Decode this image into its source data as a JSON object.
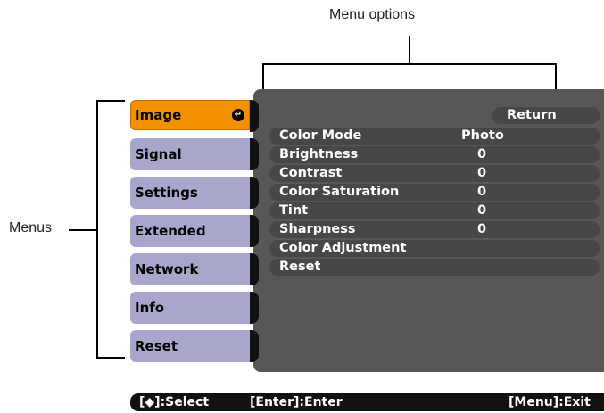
{
  "callouts": {
    "menu_options": "Menu options",
    "menus": "Menus"
  },
  "menus": [
    "Image",
    "Signal",
    "Settings",
    "Extended",
    "Network",
    "Info",
    "Reset"
  ],
  "active_menu": "Image",
  "return_label": "Return",
  "options": [
    {
      "label": "Color Mode",
      "value": "Photo"
    },
    {
      "label": "Brightness",
      "value": "0"
    },
    {
      "label": "Contrast",
      "value": "0"
    },
    {
      "label": "Color Saturation",
      "value": "0"
    },
    {
      "label": "Tint",
      "value": "0"
    },
    {
      "label": "Sharpness",
      "value": "0"
    },
    {
      "label": "Color Adjustment",
      "value": ""
    },
    {
      "label": "Reset",
      "value": ""
    }
  ],
  "status": {
    "select": "[◆]:Select",
    "enter": "[Enter]:Enter",
    "exit": "[Menu]:Exit"
  },
  "colors": {
    "active_tab": "#f39200",
    "tab": "#a9a6cc",
    "panel": "#575757"
  },
  "icons": {
    "enter": "enter-return-icon"
  }
}
